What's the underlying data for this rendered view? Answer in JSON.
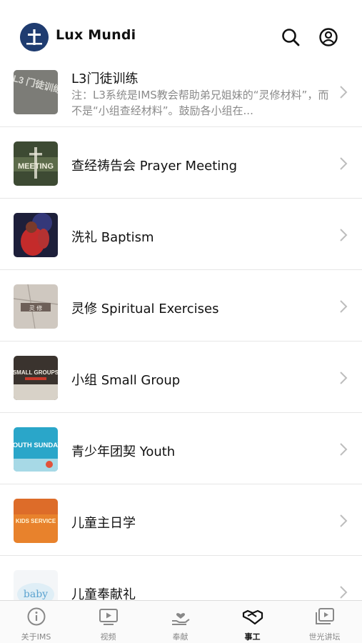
{
  "header": {
    "app_title": "Lux Mundi"
  },
  "icons": {
    "logo": "lux-mundi-logo",
    "search": "search-icon",
    "account": "account-icon",
    "chevron": "chevron-right-icon"
  },
  "ministries": [
    {
      "title": "L3门徒训练",
      "description": "注：L3系统是IMS教会帮助弟兄姐妹的“灵修材料”，而不是“小组查经材料”。鼓励各小组在...",
      "thumb_text": "L3 门徒训练"
    },
    {
      "title": "查经祷告会 Prayer Meeting",
      "thumb_text": "MEETING"
    },
    {
      "title": "洗礼 Baptism"
    },
    {
      "title": "灵修 Spiritual Exercises",
      "thumb_text": "灵 修"
    },
    {
      "title": "小组 Small Group",
      "thumb_text": "SMALL GROUPS"
    },
    {
      "title": "青少年团契 Youth",
      "thumb_text": "YOUTH SUNDAY"
    },
    {
      "title": "儿童主日学",
      "thumb_text": "KIDS SERVICE"
    },
    {
      "title": "儿童奉献礼",
      "thumb_text": "baby"
    }
  ],
  "tabbar": {
    "tabs": [
      {
        "label": "关于IMS",
        "icon": "info-icon"
      },
      {
        "label": "视频",
        "icon": "video-icon"
      },
      {
        "label": "奉献",
        "icon": "giving-icon"
      },
      {
        "label": "事工",
        "icon": "ministry-handshake-icon"
      },
      {
        "label": "世光讲坛",
        "icon": "sermon-icon"
      }
    ],
    "active_index": 3
  }
}
